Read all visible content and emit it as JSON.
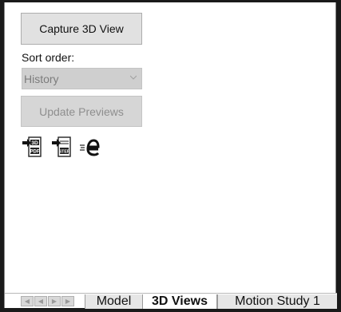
{
  "panel": {
    "capture_button": "Capture 3D View",
    "sort_label": "Sort order:",
    "sort_value": "History",
    "update_button": "Update Previews",
    "icons": [
      "export-3d-pdf-icon",
      "export-step-icon",
      "edrawings-icon"
    ],
    "icon_labels": {
      "pdf_top": "3D",
      "pdf_bottom": "PDF",
      "step": "STEP"
    }
  },
  "tabs": [
    {
      "label": "Model",
      "active": false
    },
    {
      "label": "3D Views",
      "active": true
    },
    {
      "label": "Motion Study 1",
      "active": false
    }
  ],
  "nav_buttons": [
    "first-icon",
    "prev-icon",
    "next-icon",
    "last-icon"
  ]
}
